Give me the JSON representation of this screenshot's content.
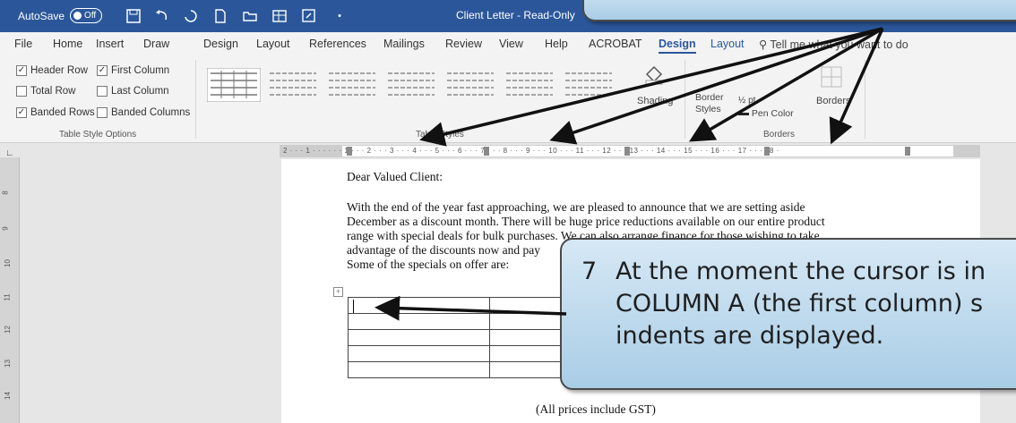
{
  "titlebar": {
    "autosave_label": "AutoSave",
    "autosave_state": "Off",
    "doc_title": "Client Letter - Read-Only",
    "icons": [
      "save-icon",
      "undo-icon",
      "redo-icon",
      "new-document-icon",
      "open-folder-icon",
      "insert-table-icon",
      "touch-mode-icon"
    ]
  },
  "tabs": [
    "File",
    "Home",
    "Insert",
    "Draw",
    "Design",
    "Layout",
    "References",
    "Mailings",
    "Review",
    "View",
    "Help",
    "ACROBAT",
    "Design",
    "Layout"
  ],
  "tell_me": "Tell me what you want to do",
  "ribbon": {
    "table_style_options": {
      "label": "Table Style Options",
      "header_row": "Header Row",
      "first_column": "First Column",
      "total_row": "Total Row",
      "last_column": "Last Column",
      "banded_rows": "Banded Rows",
      "banded_columns": "Banded Columns"
    },
    "table_styles_label": "Table Styles",
    "shading_label": "Shading",
    "borders_group_label": "Borders",
    "border_styles_label": "Border Styles",
    "pen_weight": "½ pt",
    "pen_color_label": "Pen Color",
    "borders_button_label": "Borders"
  },
  "ruler_text": "2 · · · 1 · · · · · · 1 · · · 2 · · · 3 · · · 4 · · · 5 · · · 6 · · · 7 · · · 8 · · · 9 · · · 10 · · · 11 · · · 12 · · · 13 · · · 14 · · · 15 · · · 16 · · · 17 · · · 18 ·",
  "vruler_numbers": [
    "8",
    "9",
    "10",
    "11",
    "12",
    "13",
    "14"
  ],
  "document": {
    "greeting": "Dear Valued Client:",
    "paragraph_lines": [
      "With the end of the year fast approaching, we are pleased to announce that we are setting aside",
      "December as a discount month.  There will be huge price reductions available on our entire product",
      "range with special deals for bulk purchases.  We can also arrange finance for those wishing to take",
      "advantage of the discounts now and pay",
      "Some of the specials on offer are:"
    ],
    "table_rows": 5,
    "table_cols": 4,
    "footer_note": "(All prices include GST)"
  },
  "callout": {
    "step": "7",
    "lines": [
      "At the moment the cursor is in",
      "COLUMN A (the first column) s",
      "indents are displayed."
    ]
  }
}
